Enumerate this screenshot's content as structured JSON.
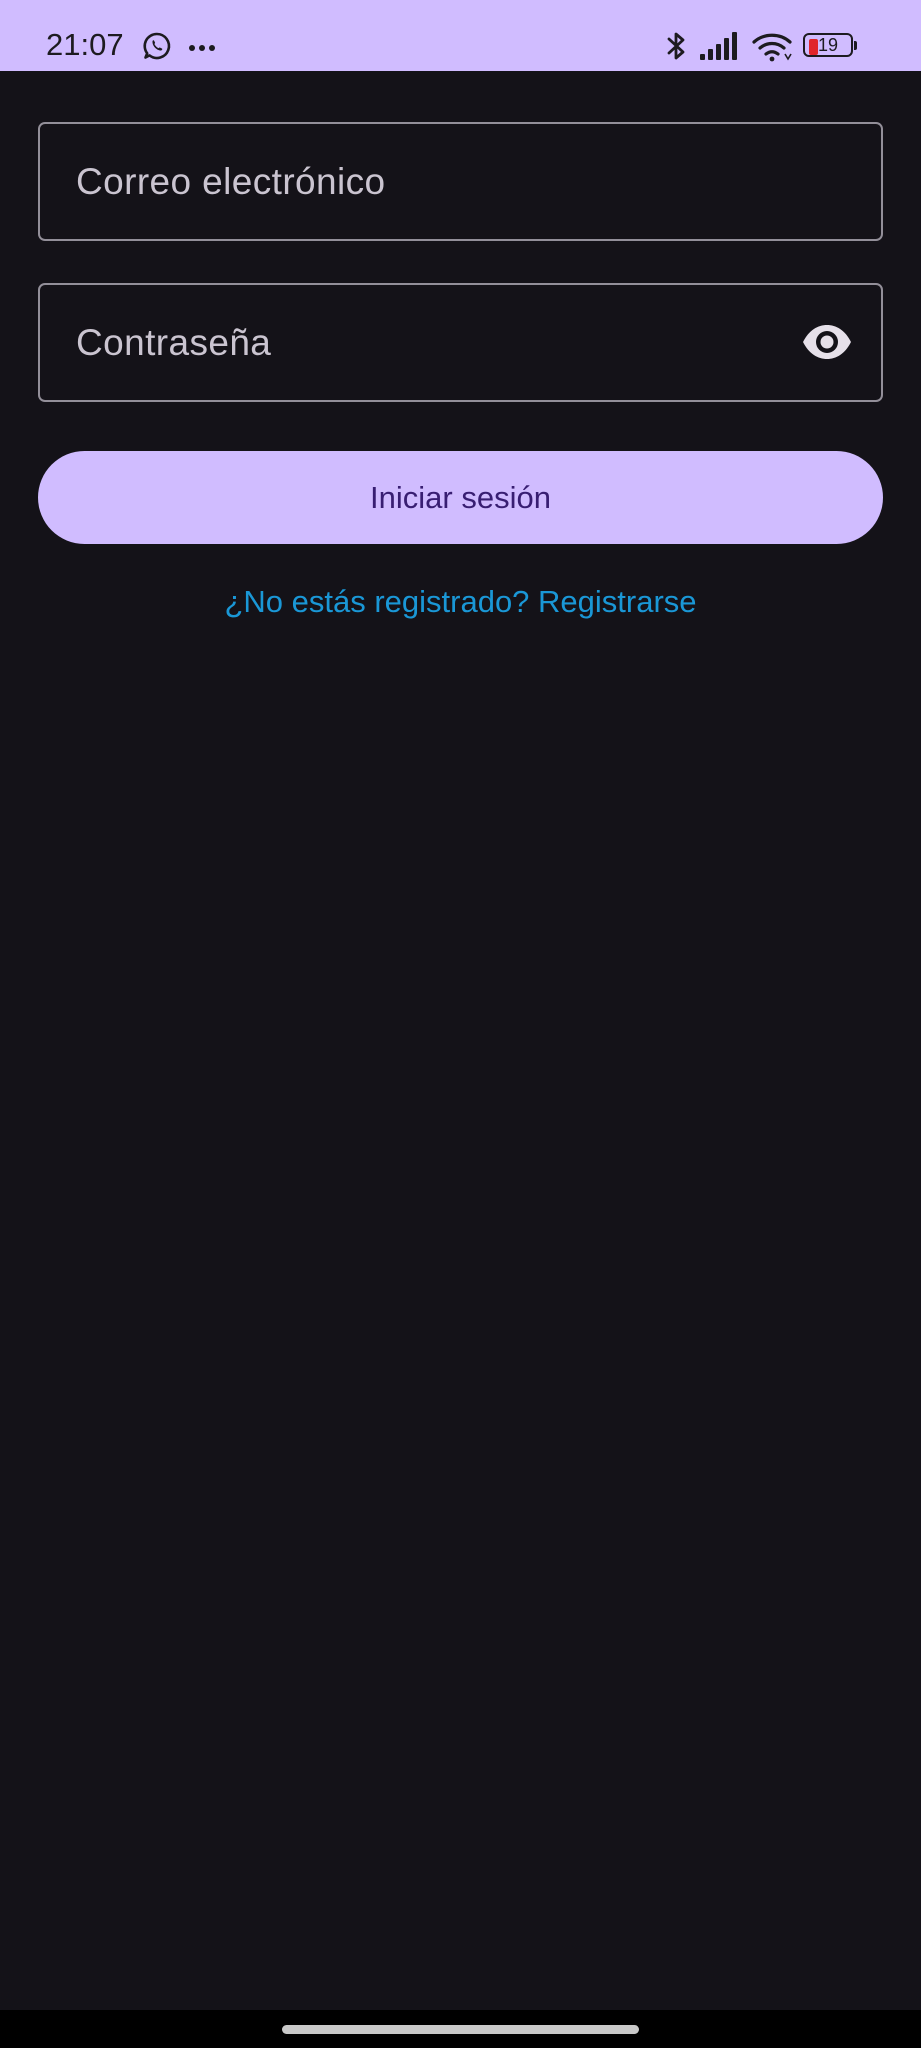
{
  "status_bar": {
    "time": "21:07",
    "battery_level": "19",
    "icons": [
      "whatsapp-icon",
      "more-icon",
      "bluetooth-icon",
      "signal-icon",
      "wifi-icon",
      "battery-icon"
    ]
  },
  "login_form": {
    "email_placeholder": "Correo electrónico",
    "password_placeholder": "Contraseña",
    "password_toggle_icon": "eye-icon",
    "submit_label": "Iniciar sesión",
    "register_link": "¿No estás registrado? Registrarse"
  },
  "colors": {
    "background": "#141218",
    "primary": "#d0bcff",
    "on_primary": "#381e72",
    "outline": "#938f99",
    "link": "#1a97d6",
    "battery_low": "#e0252b"
  }
}
